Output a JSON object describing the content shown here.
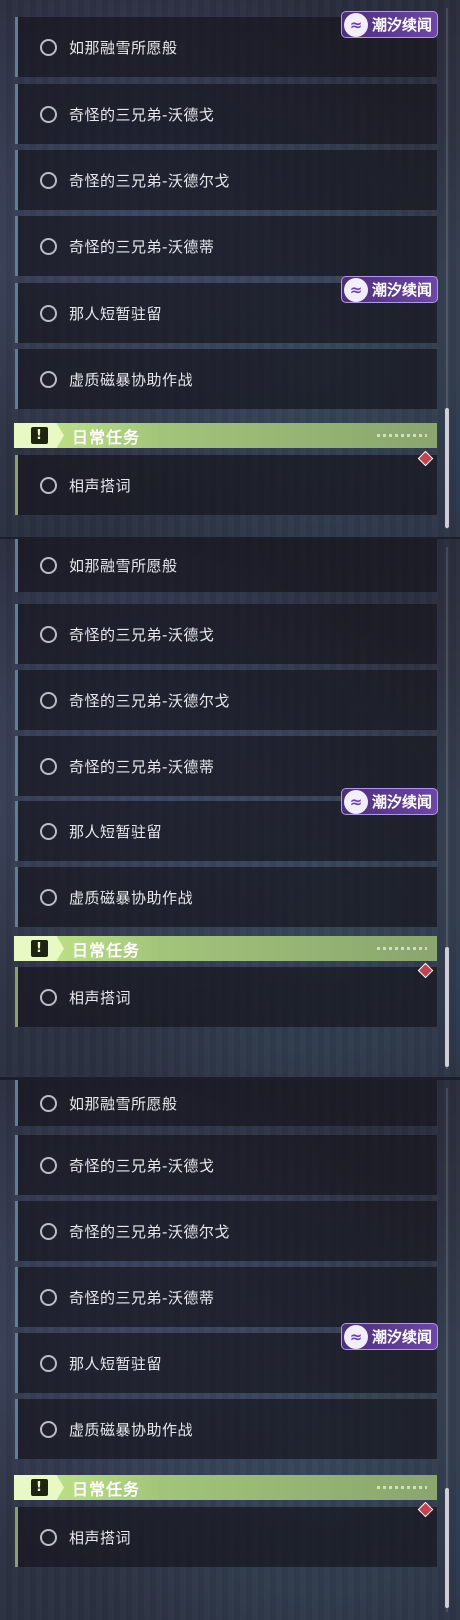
{
  "panels": [
    {
      "quests": [
        {
          "label": "如那融雪所愿般"
        },
        {
          "label": "奇怪的三兄弟-沃德戈"
        },
        {
          "label": "奇怪的三兄弟-沃德尔戈"
        },
        {
          "label": "奇怪的三兄弟-沃德蒂"
        },
        {
          "label": "那人短暂驻留"
        },
        {
          "label": "虚质磁暴协助作战"
        }
      ],
      "tag": "潮汐续闻",
      "section": {
        "title": "日常任务",
        "icon": "!"
      },
      "daily": [
        {
          "label": "相声搭词"
        }
      ]
    },
    {
      "quests": [
        {
          "label": "如那融雪所愿般"
        },
        {
          "label": "奇怪的三兄弟-沃德戈"
        },
        {
          "label": "奇怪的三兄弟-沃德尔戈"
        },
        {
          "label": "奇怪的三兄弟-沃德蒂"
        },
        {
          "label": "那人短暂驻留"
        },
        {
          "label": "虚质磁暴协助作战"
        }
      ],
      "tag": "潮汐续闻",
      "section": {
        "title": "日常任务",
        "icon": "!"
      },
      "daily": [
        {
          "label": "相声搭词"
        }
      ]
    },
    {
      "quests": [
        {
          "label": "如那融雪所愿般"
        },
        {
          "label": "奇怪的三兄弟-沃德戈"
        },
        {
          "label": "奇怪的三兄弟-沃德尔戈"
        },
        {
          "label": "奇怪的三兄弟-沃德蒂"
        },
        {
          "label": "那人短暂驻留"
        },
        {
          "label": "虚质磁暴协助作战"
        }
      ],
      "tag": "潮汐续闻",
      "section": {
        "title": "日常任务",
        "icon": "!"
      },
      "daily": [
        {
          "label": "相声搭词"
        }
      ]
    }
  ],
  "colors": {
    "tag": "#6e46a8",
    "section": "#c6ea8a",
    "marker": "#c8404c"
  },
  "icons": {
    "quest": "radio-circle-icon",
    "tag": "tidal-wave-icon",
    "section": "exclamation-icon",
    "marker": "red-diamond-icon"
  }
}
